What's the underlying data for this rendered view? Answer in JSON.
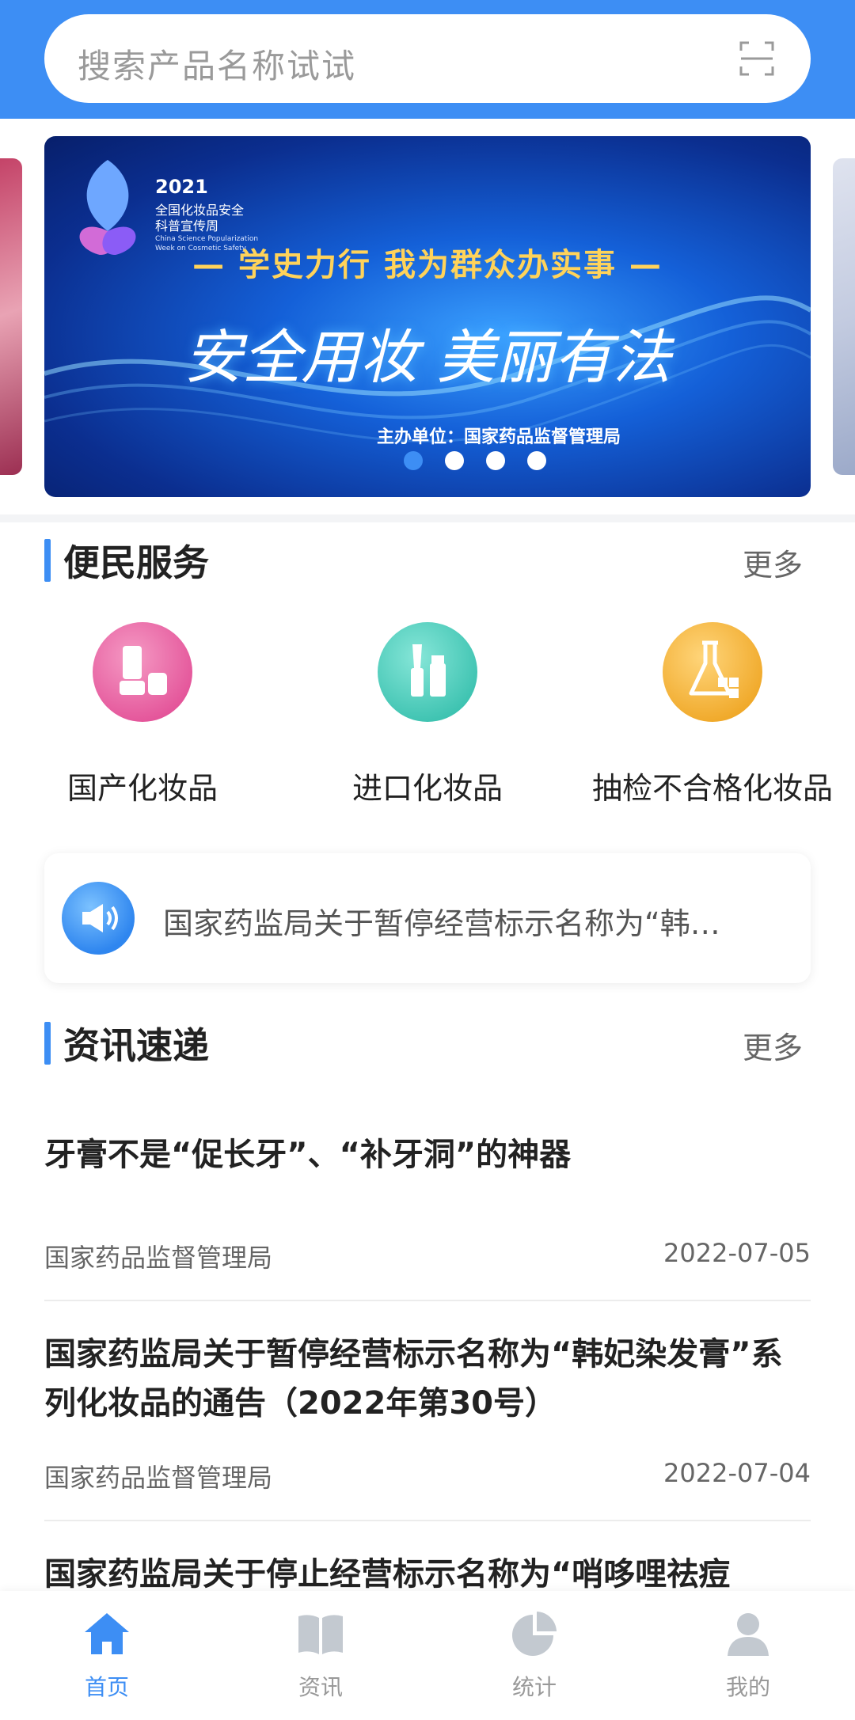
{
  "search": {
    "placeholder": "搜索产品名称试试",
    "icon": "scan-icon"
  },
  "banner": {
    "year": "2021",
    "tag_line1": "全国化妆品安全",
    "tag_line2": "科普宣传周",
    "tag_english": "China Science Popularization Week on Cosmetic Safety",
    "slogan": "— 学史力行 我为群众办实事 —",
    "main_text": "安全用妆 美丽有法",
    "host": "主办单位：国家药品监督管理局",
    "slide_count": 4,
    "active_slide": 1,
    "colors": {
      "accent": "#ffd35a",
      "base": "#1460d8"
    }
  },
  "services": {
    "title": "便民服务",
    "more": "更多",
    "items": [
      {
        "label": "国产化妆品",
        "icon": "domestic-cosmetics-icon",
        "color": "#ec6fa8"
      },
      {
        "label": "进口化妆品",
        "icon": "imported-cosmetics-icon",
        "color": "#4fd1c0"
      },
      {
        "label": "抽检不合格化妆品",
        "icon": "lab-flask-icon",
        "color": "#f4b63a"
      }
    ]
  },
  "notice": {
    "icon": "megaphone-icon",
    "text": "国家药监局关于暂停经营标示名称为“韩…"
  },
  "news": {
    "title": "资讯速递",
    "more": "更多",
    "items": [
      {
        "title": "牙膏不是“促长牙”、“补牙洞”的神器",
        "source": "国家药品监督管理局",
        "date": "2022-07-05"
      },
      {
        "title": "国家药监局关于暂停经营标示名称为“韩妃染发膏”系列化妆品的通告（2022年第30号）",
        "source": "国家药品监督管理局",
        "date": "2022-07-04"
      },
      {
        "title": "国家药监局关于停止经营标示名称为“哨哆哩祛痘"
      }
    ]
  },
  "tabbar": {
    "items": [
      {
        "label": "首页",
        "icon": "home-icon",
        "active": true
      },
      {
        "label": "资讯",
        "icon": "book-icon",
        "active": false
      },
      {
        "label": "统计",
        "icon": "pie-chart-icon",
        "active": false
      },
      {
        "label": "我的",
        "icon": "user-icon",
        "active": false
      }
    ],
    "colors": {
      "active": "#3d8ef4",
      "inactive": "#c3c9d0"
    }
  }
}
